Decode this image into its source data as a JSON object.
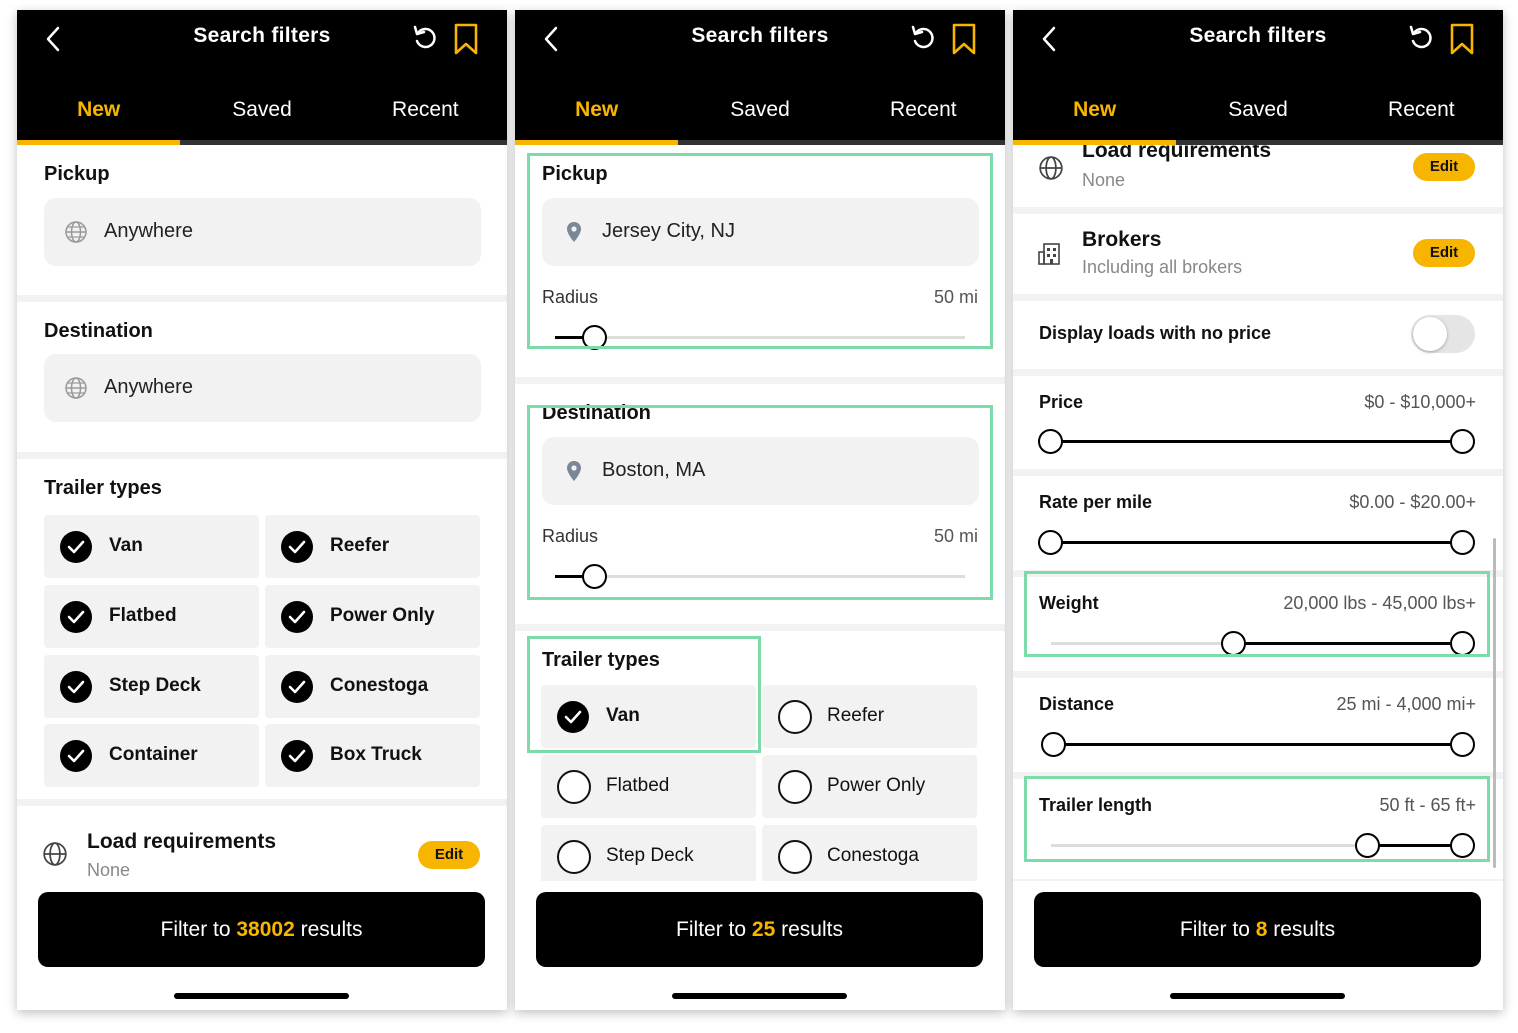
{
  "header": {
    "title": "Search filters"
  },
  "tabs": {
    "new": "New",
    "saved": "Saved",
    "recent": "Recent"
  },
  "colors": {
    "accent": "#f7b500",
    "highlight": "#7ddbaa"
  },
  "screen1": {
    "pickup": {
      "title": "Pickup",
      "value": "Anywhere"
    },
    "destination": {
      "title": "Destination",
      "value": "Anywhere"
    },
    "trailer_types": {
      "title": "Trailer types",
      "items": [
        "Van",
        "Reefer",
        "Flatbed",
        "Power Only",
        "Step Deck",
        "Conestoga",
        "Container",
        "Box Truck"
      ]
    },
    "load_req": {
      "title": "Load requirements",
      "sub": "None",
      "edit": "Edit"
    },
    "filter": {
      "pre": "Filter to ",
      "count": "38002",
      "post": " results"
    }
  },
  "screen2": {
    "pickup": {
      "title": "Pickup",
      "value": "Jersey City, NJ",
      "radius_label": "Radius",
      "radius_value": "50 mi"
    },
    "destination": {
      "title": "Destination",
      "value": "Boston, MA",
      "radius_label": "Radius",
      "radius_value": "50 mi"
    },
    "trailer_types": {
      "title": "Trailer types",
      "items": [
        "Van",
        "Reefer",
        "Flatbed",
        "Power Only",
        "Step Deck",
        "Conestoga"
      ]
    },
    "filter": {
      "pre": "Filter to ",
      "count": "25",
      "post": " results"
    }
  },
  "screen3": {
    "load_req": {
      "title": "Load requirements",
      "sub": "None",
      "edit": "Edit"
    },
    "brokers": {
      "title": "Brokers",
      "sub": "Including all brokers",
      "edit": "Edit"
    },
    "no_price": {
      "label": "Display loads with no price"
    },
    "price": {
      "label": "Price",
      "value": "$0 - $10,000+"
    },
    "rate": {
      "label": "Rate per mile",
      "value": "$0.00 - $20.00+"
    },
    "weight": {
      "label": "Weight",
      "value": "20,000 lbs - 45,000 lbs+"
    },
    "distance": {
      "label": "Distance",
      "value": "25 mi - 4,000 mi+"
    },
    "trailer_length": {
      "label": "Trailer length",
      "value": "50 ft - 65 ft+"
    },
    "filter": {
      "pre": "Filter to ",
      "count": "8",
      "post": " results"
    }
  }
}
